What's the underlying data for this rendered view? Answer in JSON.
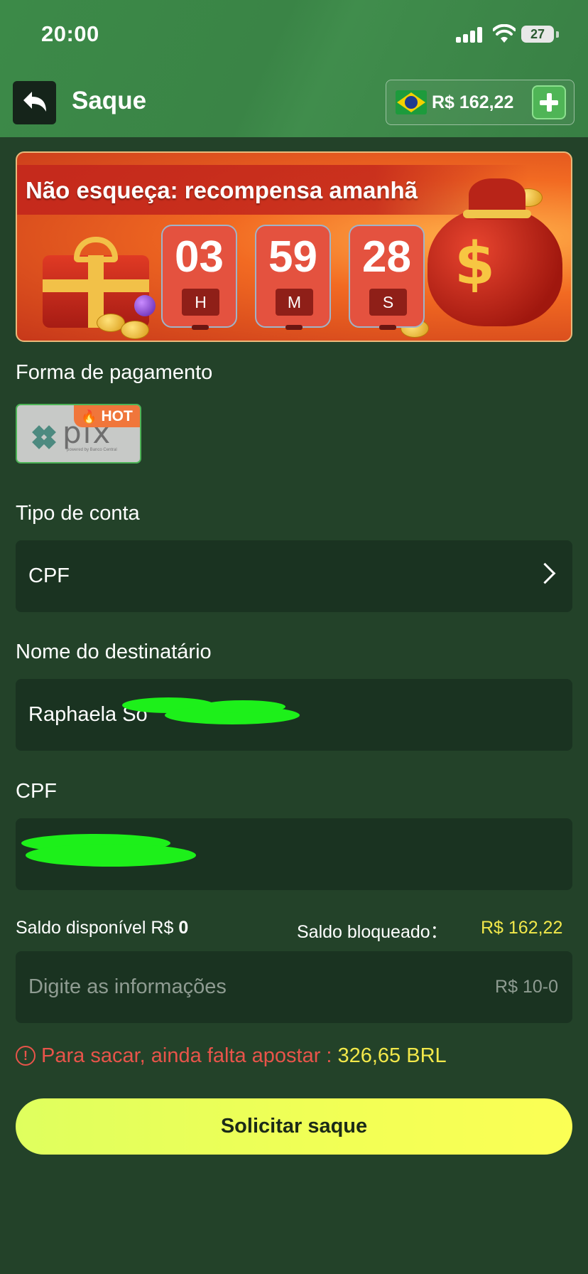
{
  "status_bar": {
    "time": "20:00",
    "battery": "27"
  },
  "header": {
    "title": "Saque",
    "balance": "R$ 162,22"
  },
  "banner": {
    "title": "Não esqueça: recompensa amanhã",
    "countdown": [
      {
        "value": "03",
        "unit": "H"
      },
      {
        "value": "59",
        "unit": "M"
      },
      {
        "value": "28",
        "unit": "S"
      }
    ]
  },
  "payment": {
    "label": "Forma de pagamento",
    "method": "pix",
    "badge": "HOT",
    "logo_sub": "powered by Banco Central"
  },
  "account_type": {
    "label": "Tipo de conta",
    "value": "CPF"
  },
  "recipient": {
    "label": "Nome do destinatário",
    "value": "Raphaela So"
  },
  "cpf": {
    "label": "CPF"
  },
  "balance_info": {
    "available_label": "Saldo disponível R$",
    "available_value": "0",
    "blocked_label": "Saldo bloqueado：",
    "blocked_value": "R$ 162,22"
  },
  "amount_input": {
    "placeholder": "Digite as informações",
    "range": "R$ 10-0"
  },
  "warning": {
    "text": "Para sacar, ainda falta apostar :",
    "amount": "326,65 BRL"
  },
  "submit_label": "Solicitar saque",
  "colors": {
    "primary_green": "#3a8446",
    "background": "#234229",
    "field": "#1a3321",
    "accent_yellow": "#f2e84a",
    "warning_red": "#e8544a"
  }
}
